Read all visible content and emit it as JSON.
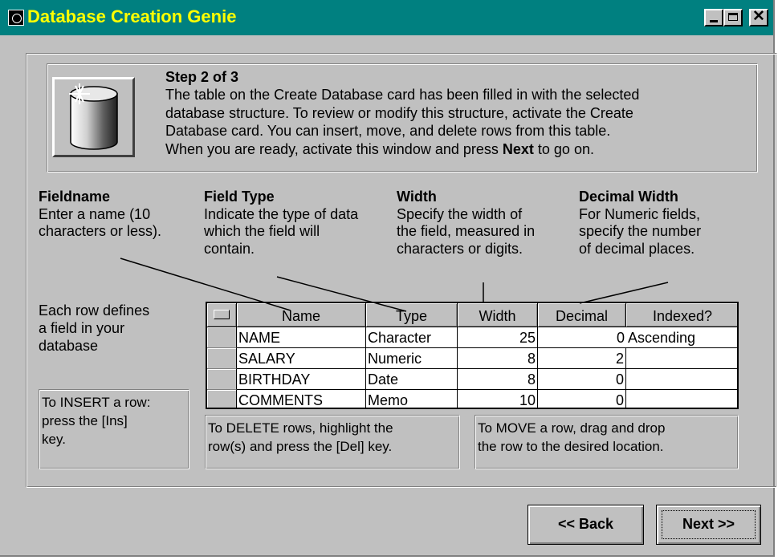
{
  "window": {
    "title": "Database Creation Genie",
    "controls": {
      "minimize": "minimize",
      "maximize": "maximize",
      "close": "✕"
    }
  },
  "header": {
    "icon": "database-cylinder-icon",
    "step": "Step 2 of 3",
    "lines": [
      "The table on the Create Database card has been filled in with the selected",
      "database structure. To review or modify this structure, activate the Create",
      "Database card. You can insert, move, and delete rows from this table."
    ],
    "last_line_before": "When you are ready, activate this window and press ",
    "last_line_bold": "Next",
    "last_line_after": " to go on."
  },
  "columns_help": [
    {
      "title": "Fieldname",
      "lines": [
        "Enter a name (10",
        "characters or less)."
      ]
    },
    {
      "title": "Field Type",
      "lines": [
        "Indicate the type of data",
        "which the field will",
        "contain."
      ]
    },
    {
      "title": "Width",
      "lines": [
        "Specify the width of",
        "the field, measured in",
        "characters or digits."
      ]
    },
    {
      "title": "Decimal Width",
      "lines": [
        "For Numeric fields,",
        "specify the number",
        "of decimal places."
      ]
    }
  ],
  "row_help": [
    "Each row defines",
    "a field in your",
    "database"
  ],
  "table": {
    "headers": [
      "Name",
      "Type",
      "Width",
      "Decimal",
      "Indexed?"
    ],
    "rows": [
      {
        "name": "NAME",
        "type": "Character",
        "width": "25",
        "decimal": "0",
        "indexed": "Ascending"
      },
      {
        "name": "SALARY",
        "type": "Numeric",
        "width": "8",
        "decimal": "2",
        "indexed": ""
      },
      {
        "name": "BIRTHDAY",
        "type": "Date",
        "width": "8",
        "decimal": "0",
        "indexed": ""
      },
      {
        "name": "COMMENTS",
        "type": "Memo",
        "width": "10",
        "decimal": "0",
        "indexed": ""
      }
    ]
  },
  "tips": {
    "insert": [
      "To INSERT a row:",
      "press the [Ins]",
      "key."
    ],
    "delete": [
      "To DELETE rows, highlight the",
      "row(s) and press the [Del] key."
    ],
    "move": [
      "To MOVE a row, drag and drop",
      "the row to the desired location."
    ]
  },
  "buttons": {
    "back": "<< Back",
    "next": "Next >>"
  },
  "colors": {
    "titlebar": "#008080",
    "title_text": "#ffff00",
    "face": "#c0c0c0"
  }
}
